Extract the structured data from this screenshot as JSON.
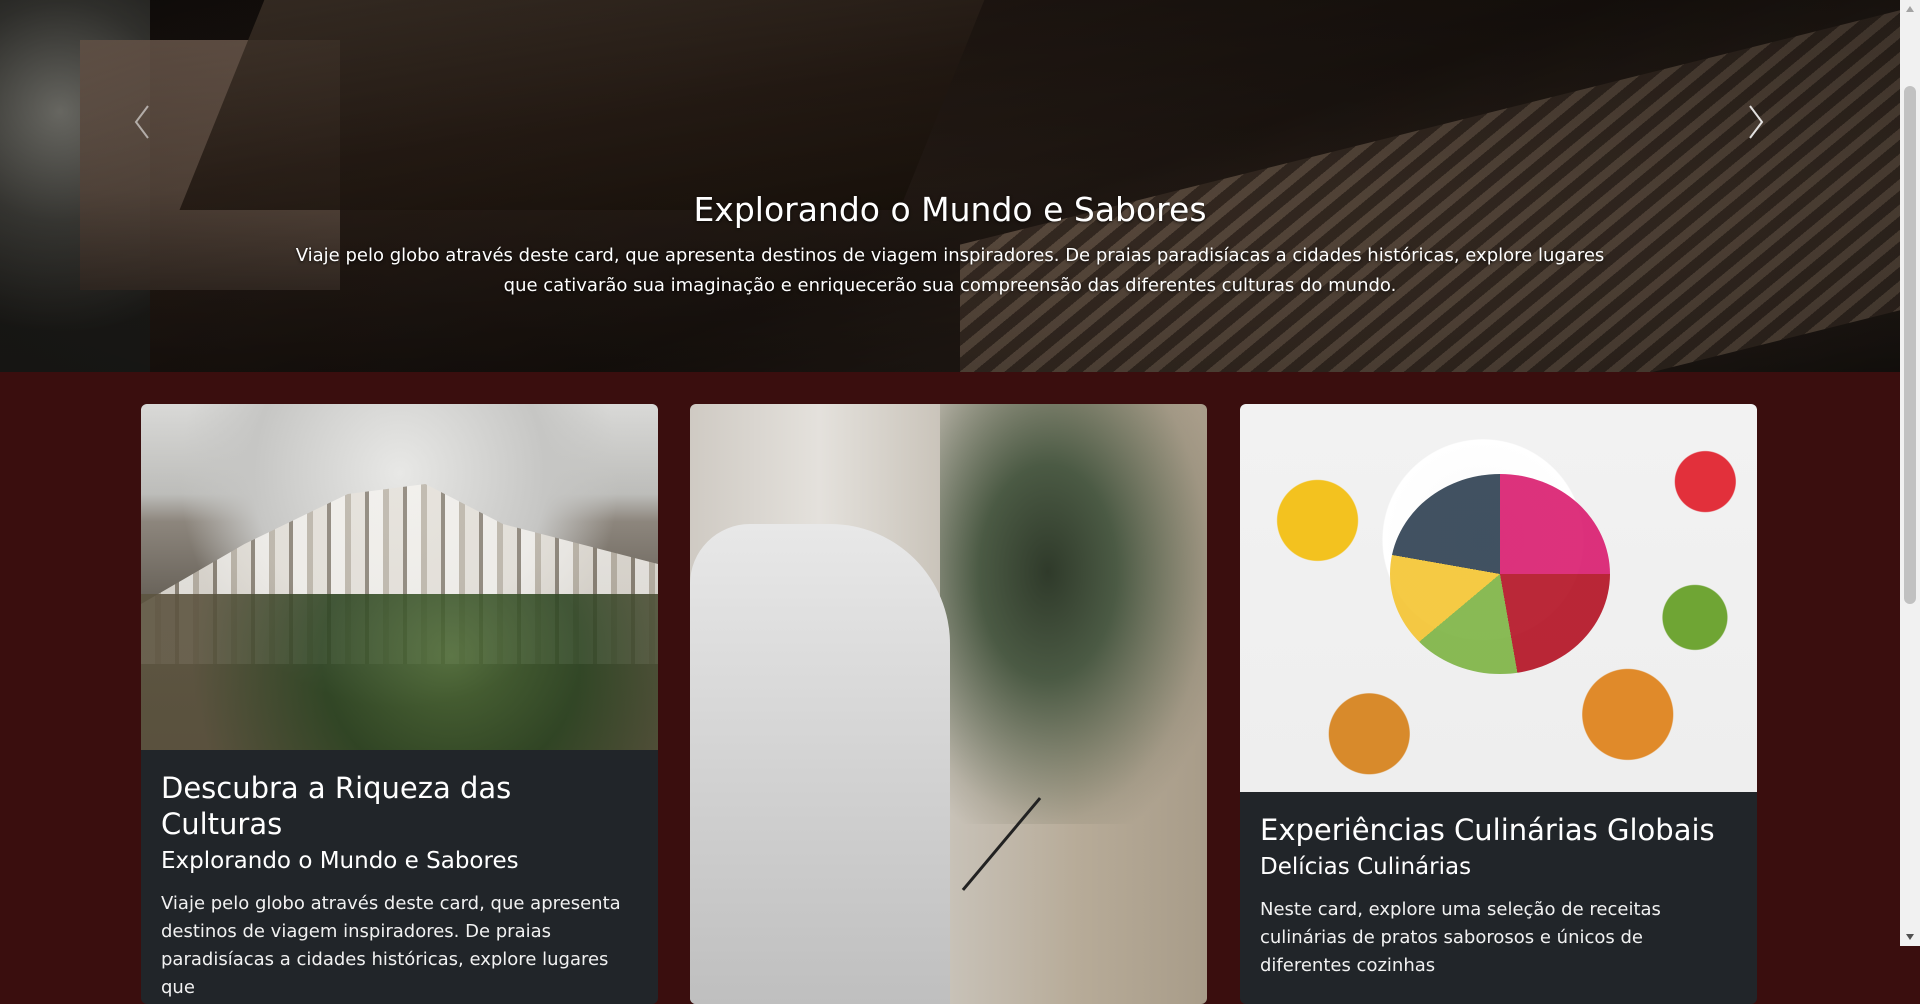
{
  "hero": {
    "title": "Explorando o Mundo e Sabores",
    "text": "Viaje pelo globo através deste card, que apresenta destinos de viagem inspiradores. De praias paradisíacas a cidades históricas, explore lugares que cativarão sua imaginação e enriquecerão sua compreensão das diferentes culturas do mundo.",
    "prev_icon": "chevron-left-icon",
    "next_icon": "chevron-right-icon"
  },
  "cards": [
    {
      "title": "Descubra a Riqueza das Culturas",
      "subtitle": "Explorando o Mundo e Sabores",
      "text": "Viaje pelo globo através deste card, que apresenta destinos de viagem inspiradores. De praias paradisíacas a cidades históricas, explore lugares que",
      "image": "hillside-monastery-photo"
    },
    {
      "title": "",
      "subtitle": "",
      "text": "",
      "image": "meditation-incense-photo"
    },
    {
      "title": "Experiências Culinárias Globais",
      "subtitle": "Delícias Culinárias",
      "text": "Neste card, explore uma seleção de receitas culinárias de pratos saborosos e únicos de diferentes cozinhas",
      "image": "fruit-bowl-photo"
    }
  ],
  "colors": {
    "page_background": "#3a0e0e",
    "card_background": "#212529",
    "text": "#ffffff"
  }
}
